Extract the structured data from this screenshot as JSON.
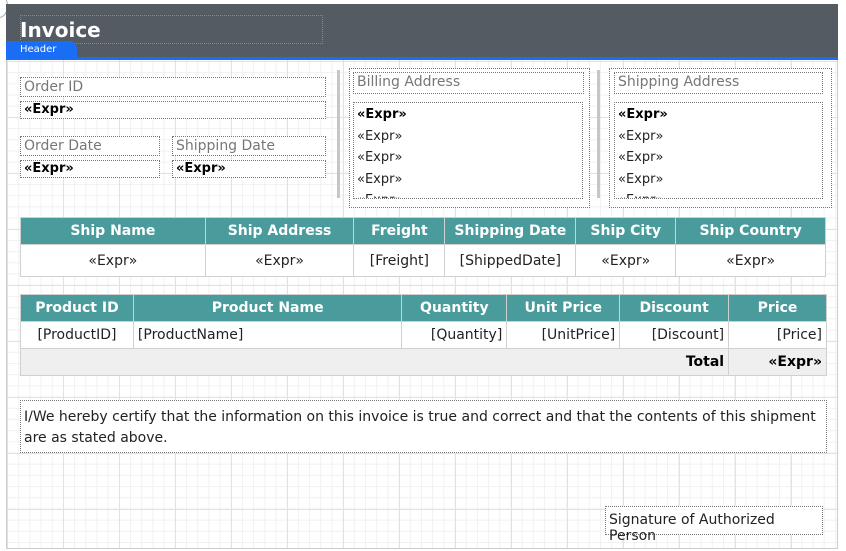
{
  "header": {
    "title": "Invoice",
    "band_label": "Header"
  },
  "order": {
    "order_id_label": "Order ID",
    "order_id_value": "«Expr»",
    "order_date_label": "Order Date",
    "order_date_value": "«Expr»",
    "shipping_date_label": "Shipping Date",
    "shipping_date_value": "«Expr»"
  },
  "billing": {
    "label": "Billing Address",
    "lines": [
      "«Expr»",
      "«Expr»",
      "«Expr»",
      "«Expr»",
      "«Expr»"
    ]
  },
  "shipping": {
    "label": "Shipping Address",
    "lines": [
      "«Expr»",
      "«Expr»",
      "«Expr»",
      "«Expr»",
      "«Expr»"
    ]
  },
  "ship_table": {
    "headers": [
      "Ship Name",
      "Ship Address",
      "Freight",
      "Shipping Date",
      "Ship City",
      "Ship Country"
    ],
    "row": [
      "«Expr»",
      "«Expr»",
      "[Freight]",
      "[ShippedDate]",
      "«Expr»",
      "«Expr»"
    ]
  },
  "product_table": {
    "headers": [
      "Product ID",
      "Product Name",
      "Quantity",
      "Unit Price",
      "Discount",
      "Price"
    ],
    "row": [
      "[ProductID]",
      "[ProductName]",
      "[Quantity]",
      "[UnitPrice]",
      "[Discount]",
      "[Price]"
    ],
    "total_label": "Total",
    "total_value": "«Expr»"
  },
  "certification": "I/We hereby certify that the information on this invoice is true and correct and that the contents of this shipment are as stated above.",
  "signature": "Signature of Authorized Person",
  "colors": {
    "header_band": "#555b63",
    "accent": "#1a6ef5",
    "table_header": "#4a9c9c"
  }
}
